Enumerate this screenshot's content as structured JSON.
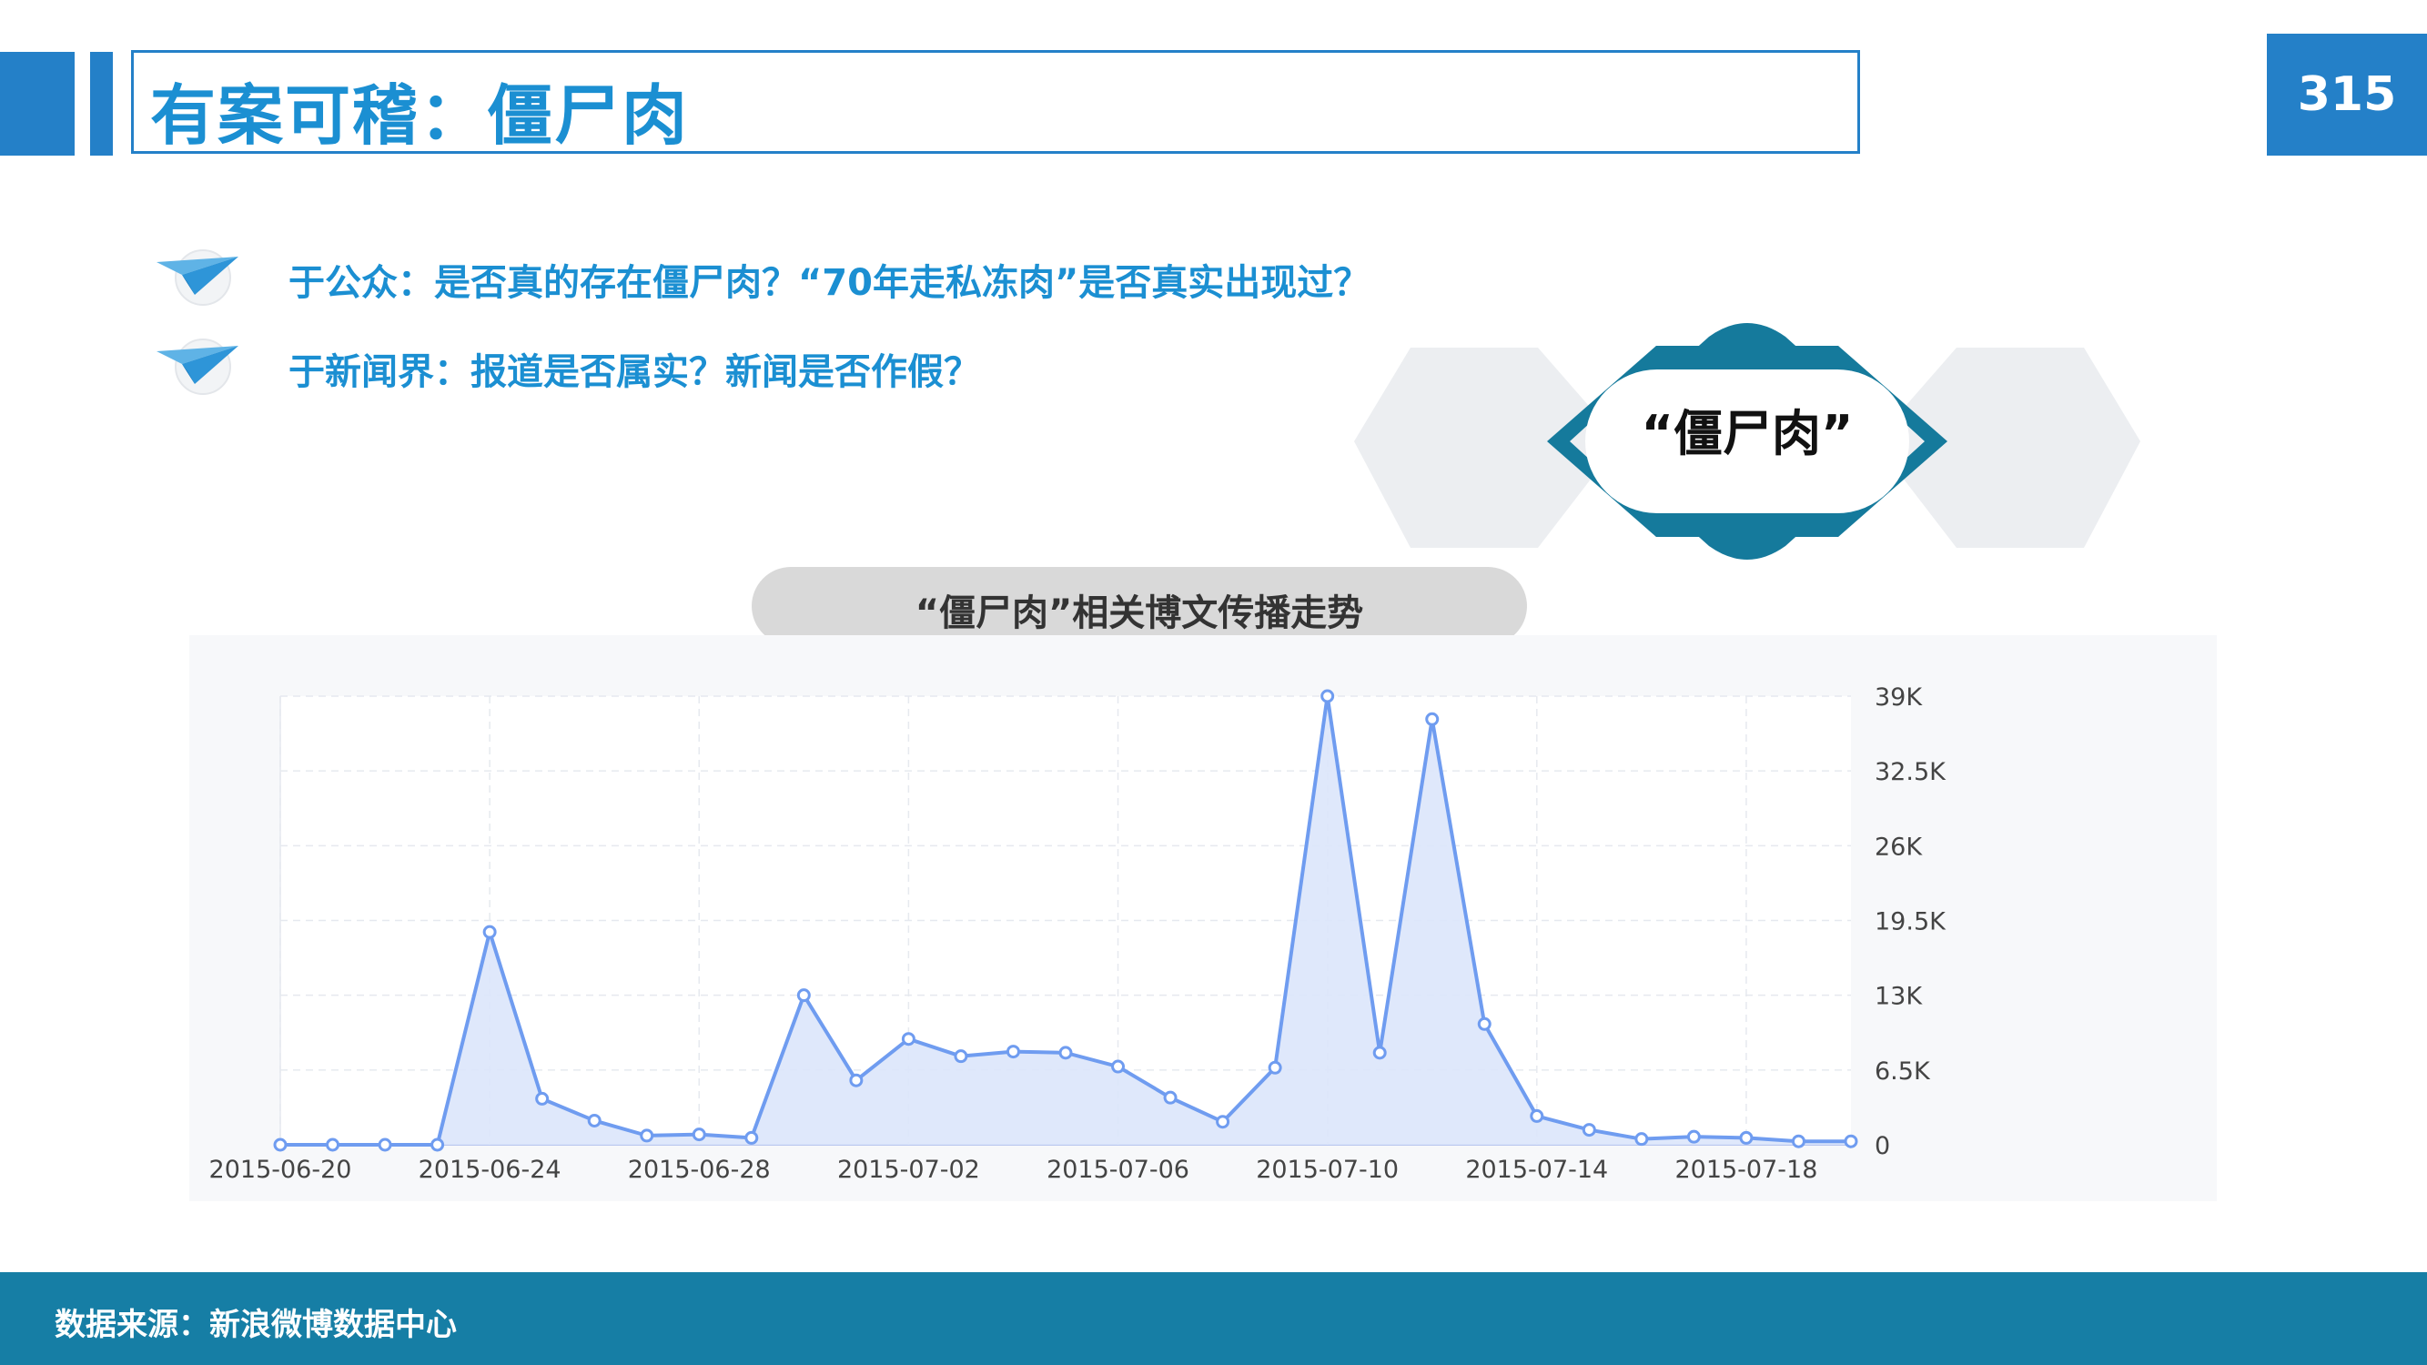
{
  "header": {
    "title": "有案可稽：僵尸肉",
    "page_number": "315"
  },
  "bullets": [
    {
      "icon": "paper-plane-icon",
      "text": "于公众：是否真的存在僵尸肉？“70年走私冻肉”是否真实出现过？"
    },
    {
      "icon": "paper-plane-icon",
      "text": "于新闻界：报道是否属实？新闻是否作假？"
    }
  ],
  "diamond": {
    "label": "“僵尸肉”"
  },
  "chart_title": "“僵尸肉”相关博文传播走势",
  "chart_data": {
    "type": "area",
    "title": "“僵尸肉”相关博文传播走势",
    "x": [
      "2015-06-20",
      "2015-06-21",
      "2015-06-22",
      "2015-06-23",
      "2015-06-24",
      "2015-06-25",
      "2015-06-26",
      "2015-06-27",
      "2015-06-28",
      "2015-06-29",
      "2015-06-30",
      "2015-07-01",
      "2015-07-02",
      "2015-07-03",
      "2015-07-04",
      "2015-07-05",
      "2015-07-06",
      "2015-07-07",
      "2015-07-08",
      "2015-07-09",
      "2015-07-10",
      "2015-07-11",
      "2015-07-12",
      "2015-07-13",
      "2015-07-14",
      "2015-07-15",
      "2015-07-16",
      "2015-07-17",
      "2015-07-18",
      "2015-07-19",
      "2015-07-20"
    ],
    "x_tick_labels": [
      "2015-06-20",
      "2015-06-24",
      "2015-06-28",
      "2015-07-02",
      "2015-07-06",
      "2015-07-10",
      "2015-07-14",
      "2015-07-18"
    ],
    "series": [
      {
        "values": [
          0,
          0,
          0,
          0,
          18500,
          4000,
          2100,
          800,
          900,
          600,
          13000,
          5600,
          9200,
          7700,
          8100,
          8000,
          6800,
          4100,
          2000,
          6700,
          39000,
          8000,
          37000,
          10500,
          2500,
          1300,
          500,
          700,
          600,
          300,
          300
        ]
      }
    ],
    "ylim": [
      0,
      39000
    ],
    "y_ticks": [
      0,
      6500,
      13000,
      19500,
      26000,
      32500,
      39000
    ],
    "y_tick_labels": [
      "0",
      "6.5K",
      "13K",
      "19.5K",
      "26K",
      "32.5K",
      "39K"
    ],
    "y_axis_side": "right",
    "grid": true,
    "line_color": "#6f9cf0",
    "fill_color": "#dbe6fb"
  },
  "footer": {
    "source": "数据来源：新浪微博数据中心"
  },
  "colors": {
    "accent": "#2480c8",
    "title_text": "#1b8fd2",
    "footer_bg": "#167ea5",
    "diamond_teal": "#157a9c"
  }
}
